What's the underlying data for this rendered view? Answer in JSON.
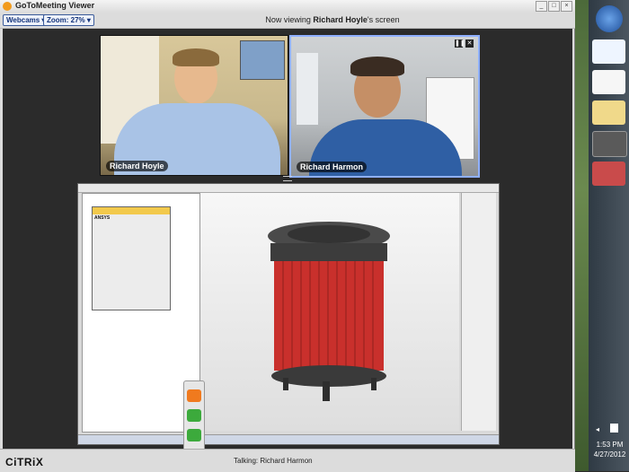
{
  "app": {
    "title": "GoToMeeting Viewer",
    "viewing_prefix": "Now viewing ",
    "viewing_name": "Richard Hoyle",
    "viewing_suffix": "'s screen"
  },
  "toolbar": {
    "webcams_label": "Webcams ▾",
    "zoom_label": "Zoom: 27% ▾"
  },
  "webcams": [
    {
      "name": "Richard Hoyle"
    },
    {
      "name": "Richard Harmon"
    }
  ],
  "status": {
    "talking_label": "Talking:",
    "talking_name": "Richard Harmon"
  },
  "brand": {
    "name": "CiTRiX"
  },
  "clock": {
    "time": "1:53 PM",
    "date": "4/27/2012"
  },
  "shared_screen": {
    "dialog_header": "ANSYS"
  },
  "colors": {
    "accent": "#f29b1d",
    "highlight_border": "#8fb0ff",
    "model_red": "#c9302c"
  }
}
